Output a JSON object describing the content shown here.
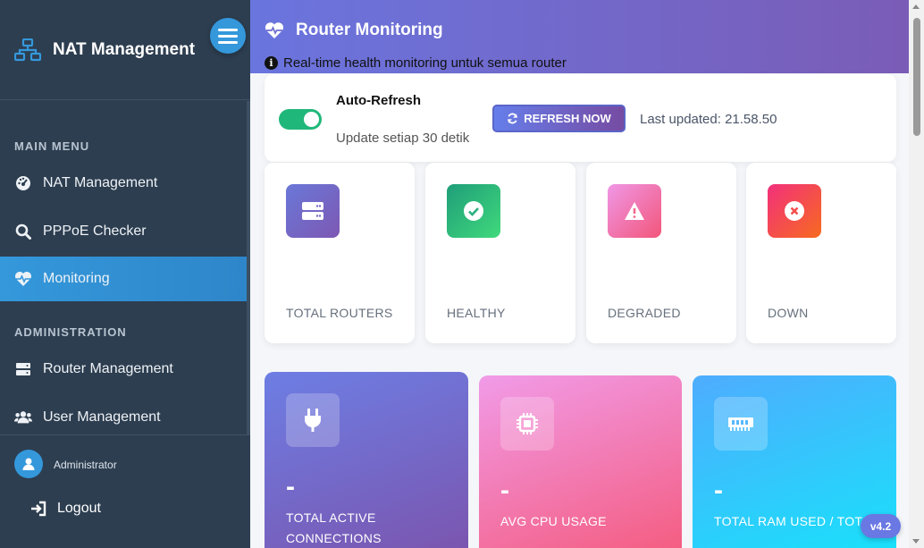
{
  "sidebar": {
    "brand": "NAT Management",
    "sections": {
      "main_menu": "MAIN MENU",
      "administration": "ADMINISTRATION"
    },
    "items": [
      {
        "label": "NAT Management",
        "icon": "dashboard-icon"
      },
      {
        "label": "PPPoE Checker",
        "icon": "search-icon"
      },
      {
        "label": "Monitoring",
        "icon": "heartbeat-icon",
        "active": true
      },
      {
        "label": "Router Management",
        "icon": "server-icon"
      },
      {
        "label": "User Management",
        "icon": "users-icon"
      }
    ],
    "user": {
      "name": "Administrator"
    },
    "logout": "Logout"
  },
  "header": {
    "title": "Router Monitoring",
    "subtitle": "Real-time health monitoring untuk semua router"
  },
  "auto_refresh": {
    "title": "Auto-Refresh",
    "subtitle": "Update setiap 30 detik",
    "enabled": true,
    "button_label": "REFRESH NOW",
    "last_updated": "Last updated: 21.58.50"
  },
  "stats": [
    {
      "label": "TOTAL ROUTERS",
      "icon": "server-icon",
      "color": "#7c6fd0"
    },
    {
      "label": "HEALTHY",
      "icon": "check-circle-icon",
      "color": "#2bc48a"
    },
    {
      "label": "DEGRADED",
      "icon": "warning-icon",
      "color": "#f26b8a"
    },
    {
      "label": "DOWN",
      "icon": "x-circle-icon",
      "color": "#f5576c"
    }
  ],
  "metrics": [
    {
      "value": "-",
      "label_line1": "TOTAL ACTIVE",
      "label_line2": "CONNECTIONS",
      "icon": "plug-icon"
    },
    {
      "value": "-",
      "label_line1": "AVG CPU USAGE",
      "label_line2": "",
      "icon": "cpu-icon"
    },
    {
      "value": "-",
      "label_line1": "TOTAL RAM USED / TOTAL",
      "label_line2": "",
      "icon": "memory-icon"
    }
  ],
  "version": "v4.2",
  "colors": {
    "sidebar_bg": "#2d3e50",
    "accent_blue": "#3498db",
    "header_gradient_start": "#6a75de",
    "header_gradient_end": "#7b5bb5",
    "toggle_on": "#20b77a"
  }
}
